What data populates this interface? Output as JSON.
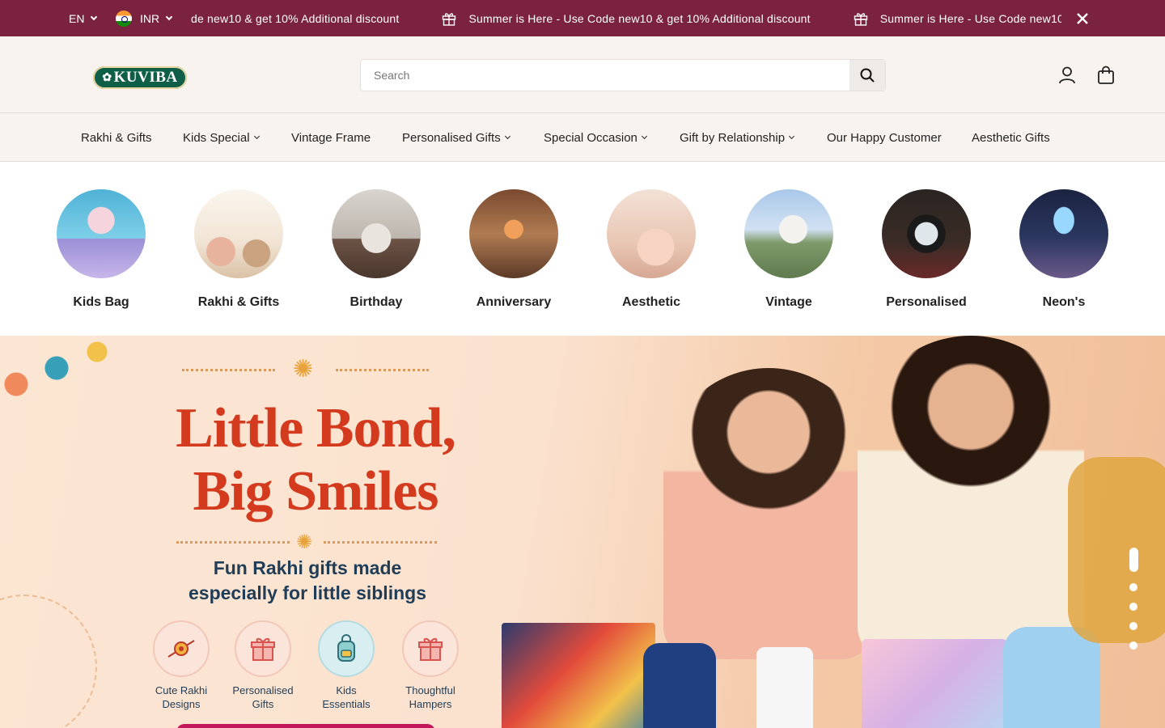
{
  "topbar": {
    "language": "EN",
    "currency": "INR",
    "announcements": [
      "de new10 & get 10% Additional discount",
      "Summer is Here - Use Code new10 & get 10% Additional discount",
      "Summer is Here - Use Code new10 &"
    ],
    "bg_color": "#7a2240"
  },
  "header": {
    "logo_text": "KUVIBA",
    "search_placeholder": "Search"
  },
  "nav": {
    "items": [
      {
        "label": "Rakhi & Gifts",
        "dropdown": false
      },
      {
        "label": "Kids Special",
        "dropdown": true
      },
      {
        "label": "Vintage Frame",
        "dropdown": false
      },
      {
        "label": "Personalised Gifts",
        "dropdown": true
      },
      {
        "label": "Special Occasion",
        "dropdown": true
      },
      {
        "label": "Gift by Relationship",
        "dropdown": true
      },
      {
        "label": "Our Happy Customer",
        "dropdown": false
      },
      {
        "label": "Aesthetic Gifts",
        "dropdown": false
      }
    ]
  },
  "categories": [
    {
      "label": "Kids Bag"
    },
    {
      "label": "Rakhi & Gifts"
    },
    {
      "label": "Birthday"
    },
    {
      "label": "Anniversary"
    },
    {
      "label": "Aesthetic"
    },
    {
      "label": "Vintage"
    },
    {
      "label": "Personalised"
    },
    {
      "label": "Neon's"
    }
  ],
  "hero": {
    "title_line1": "Little Bond,",
    "title_line2": "Big Smiles",
    "subtitle_line1": "Fun Rakhi gifts made",
    "subtitle_line2": "especially for little siblings",
    "features": [
      {
        "line1": "Cute Rakhi",
        "line2": "Designs",
        "icon": "rakhi-icon"
      },
      {
        "line1": "Personalised",
        "line2": "Gifts",
        "icon": "gift-icon"
      },
      {
        "line1": "Kids",
        "line2": "Essentials",
        "icon": "backpack-icon"
      },
      {
        "line1": "Thoughtful",
        "line2": "Hampers",
        "icon": "hamper-icon"
      }
    ],
    "slides_total": 5,
    "slide_active": 1
  }
}
